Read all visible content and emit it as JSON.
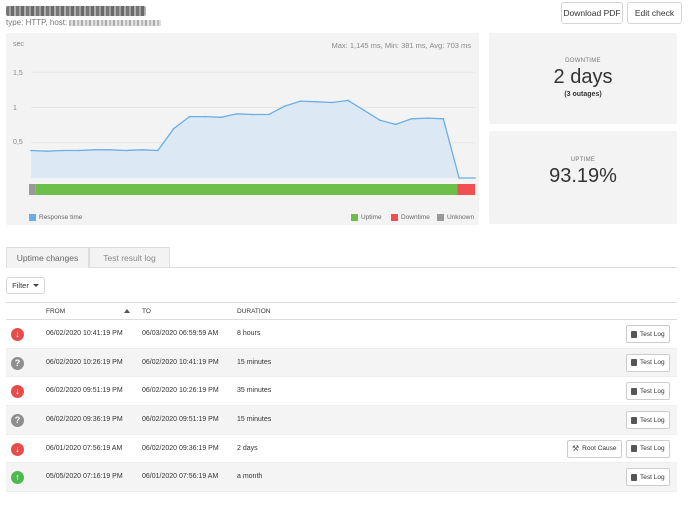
{
  "header": {
    "subtitle_prefix": "type: HTTP, host:",
    "download_pdf": "Download PDF",
    "edit_check": "Edit check"
  },
  "chart": {
    "stats": "Max: 1,145 ms, Min: 381 ms, Avg: 703 ms",
    "y_unit": "sec",
    "legend": {
      "response_time": "Response time",
      "uptime": "Uptime",
      "downtime": "Downtime",
      "unknown": "Unknown"
    },
    "colors": {
      "response_line": "#6aaee8",
      "response_fill": "#dce9f5",
      "uptime": "#6cc04a",
      "downtime": "#f05050",
      "unknown": "#999999"
    }
  },
  "chart_data": {
    "type": "area",
    "ylabel": "sec",
    "yticks": [
      "0,5",
      "1",
      "1,5"
    ],
    "ylim": [
      0,
      1.9
    ],
    "values": [
      0.39,
      0.38,
      0.39,
      0.39,
      0.4,
      0.4,
      0.39,
      0.4,
      0.39,
      0.7,
      0.87,
      0.87,
      0.86,
      0.91,
      0.9,
      0.9,
      1.02,
      1.09,
      1.08,
      1.07,
      1.1,
      0.96,
      0.82,
      0.76,
      0.84,
      0.85,
      0.84,
      0.0,
      0.0
    ],
    "status_bar": {
      "unknown": 0.015,
      "uptime": 0.945,
      "downtime": 0.04
    }
  },
  "downtime_card": {
    "label": "DOWNTIME",
    "value": "2 days",
    "detail": "(3 outages)"
  },
  "uptime_card": {
    "label": "UPTIME",
    "value": "93.19%"
  },
  "tabs": [
    "Uptime changes",
    "Test result log"
  ],
  "filter_label": "Filter",
  "table": {
    "headers": {
      "from": "FROM",
      "to": "TO",
      "duration": "DURATION"
    },
    "test_log_label": "Test Log",
    "root_cause_label": "Root Cause",
    "rows": [
      {
        "status": "down",
        "from": "06/02/2020 10:41:19 PM",
        "to": "06/03/2020 06:59:59 AM",
        "duration": "8 hours"
      },
      {
        "status": "unknown",
        "from": "06/02/2020 10:26:19 PM",
        "to": "06/02/2020 10:41:19 PM",
        "duration": "15 minutes"
      },
      {
        "status": "down",
        "from": "06/02/2020 09:51:19 PM",
        "to": "06/02/2020 10:26:19 PM",
        "duration": "35 minutes"
      },
      {
        "status": "unknown",
        "from": "06/02/2020 09:36:19 PM",
        "to": "06/02/2020 09:51:19 PM",
        "duration": "15 minutes"
      },
      {
        "status": "down",
        "from": "06/01/2020 07:56:19 AM",
        "to": "06/02/2020 09:36:19 PM",
        "duration": "2 days"
      },
      {
        "status": "up",
        "from": "05/05/2020 07:16:19 PM",
        "to": "06/01/2020 07:56:19 AM",
        "duration": "a month"
      }
    ]
  }
}
